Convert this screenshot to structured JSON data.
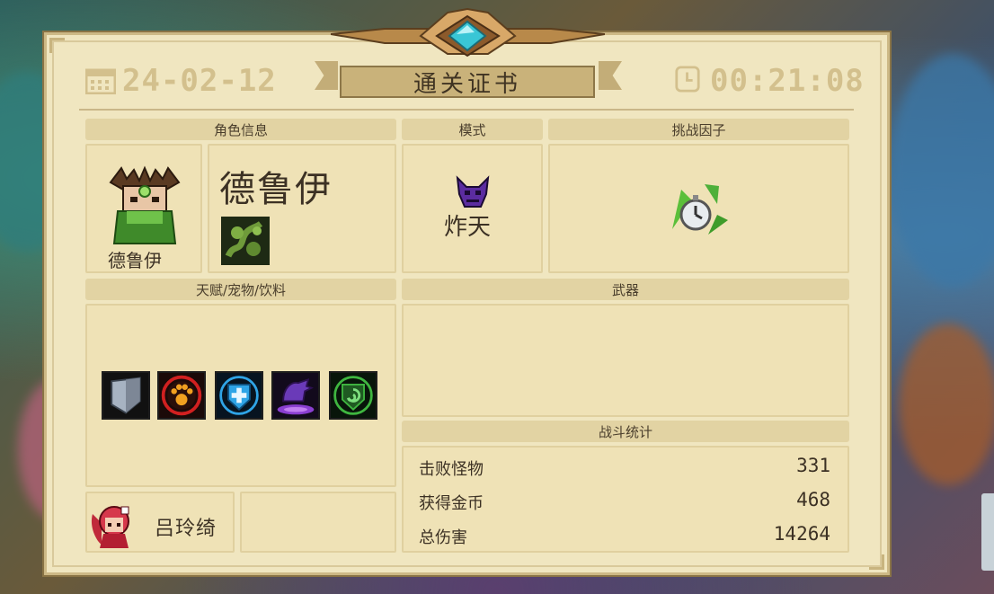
{
  "header": {
    "date": "24-02-12",
    "title": "通关证书",
    "time": "00:21:08",
    "calendar_icon": "calendar-icon",
    "clock_icon": "clock-icon"
  },
  "sections": {
    "character_info": "角色信息",
    "mode": "模式",
    "challenge_factors": "挑战因子",
    "talents_pets_drinks": "天赋/宠物/饮料",
    "weapons": "武器",
    "battle_stats": "战斗统计"
  },
  "character": {
    "name": "德鲁伊",
    "portrait_name": "德鲁伊",
    "skill_icon": "vine-skill-icon"
  },
  "mode": {
    "name": "炸天",
    "icon": "demon-mask-icon"
  },
  "challenge": {
    "icon": "stopwatch-arrows-icon"
  },
  "buffs": [
    {
      "icon": "shield-armor-icon",
      "color": "#8a97a8"
    },
    {
      "icon": "paw-icon",
      "color": "#e88f1e"
    },
    {
      "icon": "blue-cross-shield-icon",
      "color": "#2fa4e6"
    },
    {
      "icon": "purple-hand-icon",
      "color": "#8a3fd1"
    },
    {
      "icon": "green-swirl-shield-icon",
      "color": "#3fb640"
    }
  ],
  "pet": {
    "name": "吕玲绮",
    "icon": "red-hair-companion-icon"
  },
  "stats": [
    {
      "label": "击败怪物",
      "value": "331"
    },
    {
      "label": "获得金币",
      "value": "468"
    },
    {
      "label": "总伤害",
      "value": "14264"
    }
  ],
  "colors": {
    "panel": "#f0e6c0",
    "header_gold": "#d3c08d",
    "accent_gem": "#39c6d6"
  }
}
